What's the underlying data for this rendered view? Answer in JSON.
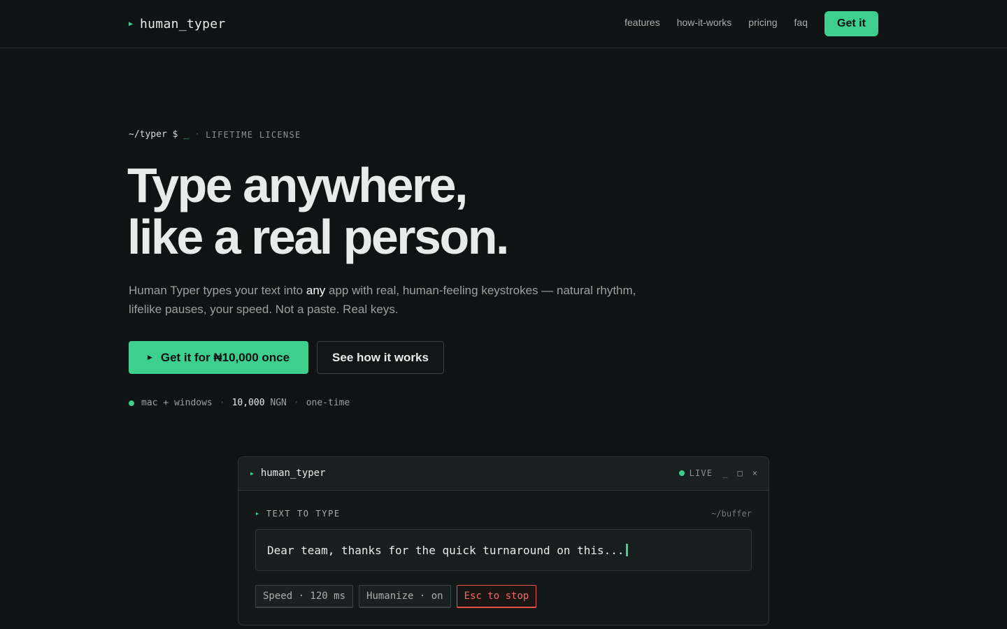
{
  "nav": {
    "brand_name": "human_typer",
    "links": [
      "features",
      "how-it-works",
      "pricing",
      "faq"
    ],
    "cta_label": "Get it"
  },
  "hero": {
    "prompt": "~/typer $",
    "prompt_cursor": "_",
    "badge": "LIFETIME LICENSE",
    "headline_line1": "Type anywhere,",
    "headline_line2": "like a real person.",
    "lede_before": "Human Typer types your text into ",
    "lede_em": "any",
    "lede_after": " app with real, human-feeling keystrokes — natural rhythm, lifelike pauses, your speed. Not a paste. Real keys.",
    "primary_cta": "Get it for ₦10,000 once",
    "secondary_cta": "See how it works",
    "meta_platforms": "mac + windows",
    "meta_price_value": "10,000",
    "meta_price_currency": "NGN",
    "meta_term": "one-time"
  },
  "app_window": {
    "title": "human_typer",
    "status": "LIVE",
    "controls": {
      "minimize": "_",
      "maximize": "□",
      "close": "×"
    },
    "section_label": "TEXT TO TYPE",
    "section_path": "~/buffer",
    "buffer_text": "Dear team, thanks for the quick turnaround on this...",
    "chips": {
      "speed": "Speed · 120 ms",
      "humanize": "Humanize · on",
      "stop": "Esc to stop"
    }
  },
  "colors": {
    "background": "#0f1314",
    "accent": "#3ecf8e",
    "danger": "#e5534b",
    "text": "#e8ebea",
    "muted": "#9aa19f"
  }
}
